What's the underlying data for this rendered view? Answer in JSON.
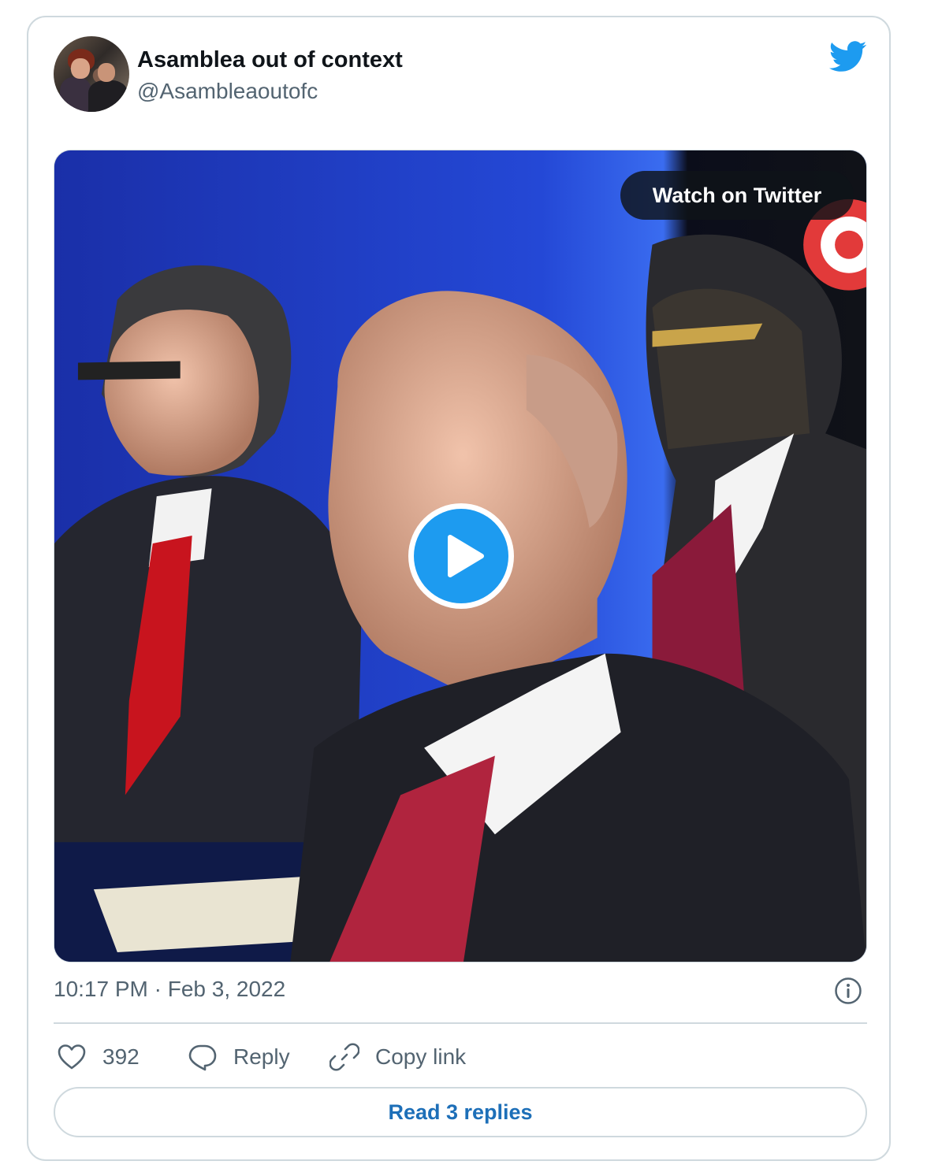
{
  "tweet": {
    "author_name": "Asamblea out of context",
    "author_handle": "@Asambleaoutofc",
    "timestamp": "10:17 PM · Feb 3, 2022",
    "media": {
      "watch_label": "Watch on Twitter"
    },
    "actions": {
      "like_count": "392",
      "reply_label": "Reply",
      "copy_link_label": "Copy link"
    },
    "read_replies_label": "Read 3 replies"
  },
  "colors": {
    "twitter_blue": "#1d9bf0",
    "link_blue": "#1d6fb8",
    "text_primary": "#0f1419",
    "text_secondary": "#536471",
    "border": "#cfd9de"
  },
  "icons": {
    "brand": "twitter-bird-icon",
    "like": "heart-icon",
    "reply": "speech-bubble-icon",
    "copy_link": "link-icon",
    "info": "info-icon",
    "play": "play-icon"
  }
}
